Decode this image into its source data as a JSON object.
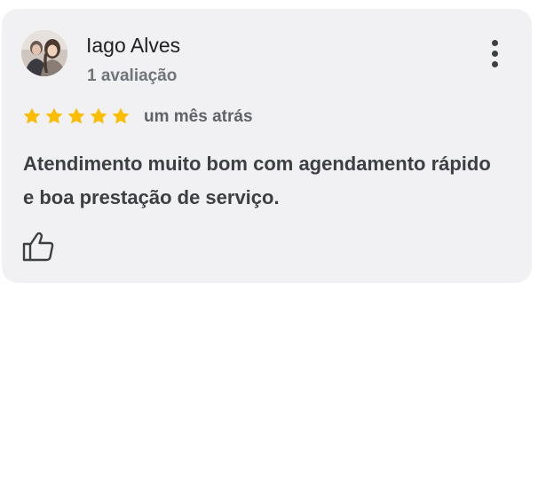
{
  "review": {
    "author": {
      "name": "Iago Alves",
      "review_count": "1 avaliação",
      "avatar_icon": "profile-photo"
    },
    "rating": {
      "stars": 5,
      "max": 5,
      "star_color": "#fbbc04"
    },
    "date": "um mês atrás",
    "text": "Atendimento muito bom com agendamento rápido e boa prestação de serviço.",
    "menu_icon": "more-vert-icon",
    "like_icon": "thumb-up-icon"
  },
  "colors": {
    "card_background": "#f1f1f3",
    "name_text": "#202124",
    "secondary_text": "#70757a",
    "body_text": "#3c4043"
  }
}
